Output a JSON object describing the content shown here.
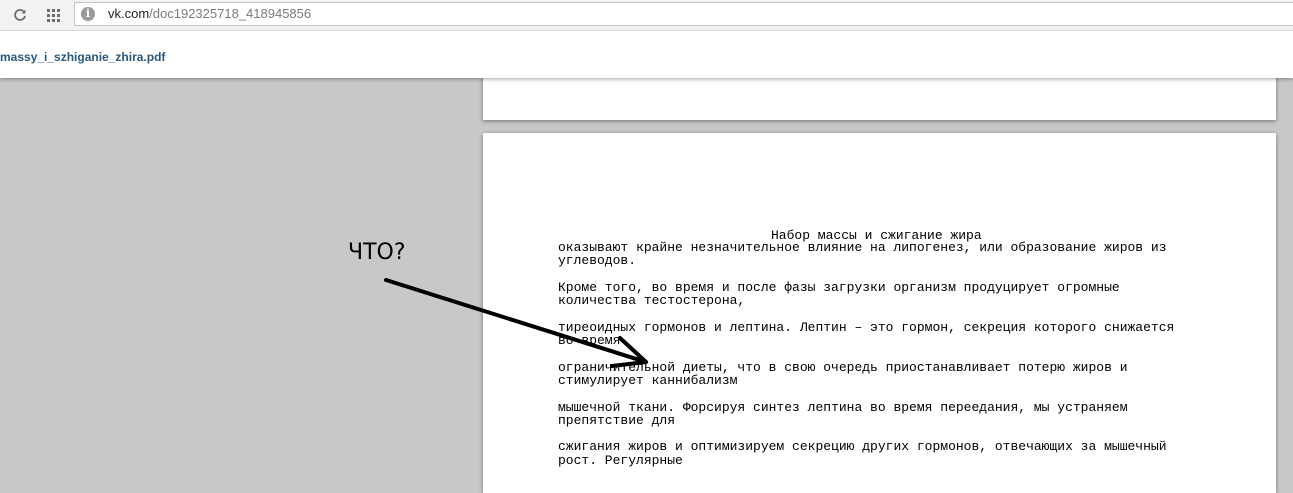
{
  "browser": {
    "url_host": "vk.com",
    "url_path": "/doc192325718_418945856"
  },
  "viewer": {
    "filename": "massy_i_szhiganie_zhira.pdf"
  },
  "document": {
    "title": "Набор массы и сжигание жира",
    "paragraphs": [
      "оказывают крайне незначительное влияние на липогенез, или образование жиров из\nуглеводов.",
      "Кроме того, во время и после фазы загрузки организм продуцирует огромные\nколичества тестостерона,",
      "тиреоидных гормонов и лептина. Лептин – это гормон, секреция которого снижается\nво время",
      "ограничительной диеты, что в свою очередь приостанавливает потерю жиров и\nстимулирует каннибализм",
      "мышечной ткани. Форсируя синтез лептина во время переедания, мы устраняем\nпрепятствие для",
      "сжигания жиров и оптимизируем секрецию других гормонов, отвечающих за мышечный\nрост. Регулярные"
    ]
  },
  "annotation": {
    "label": "ЧТО?"
  }
}
